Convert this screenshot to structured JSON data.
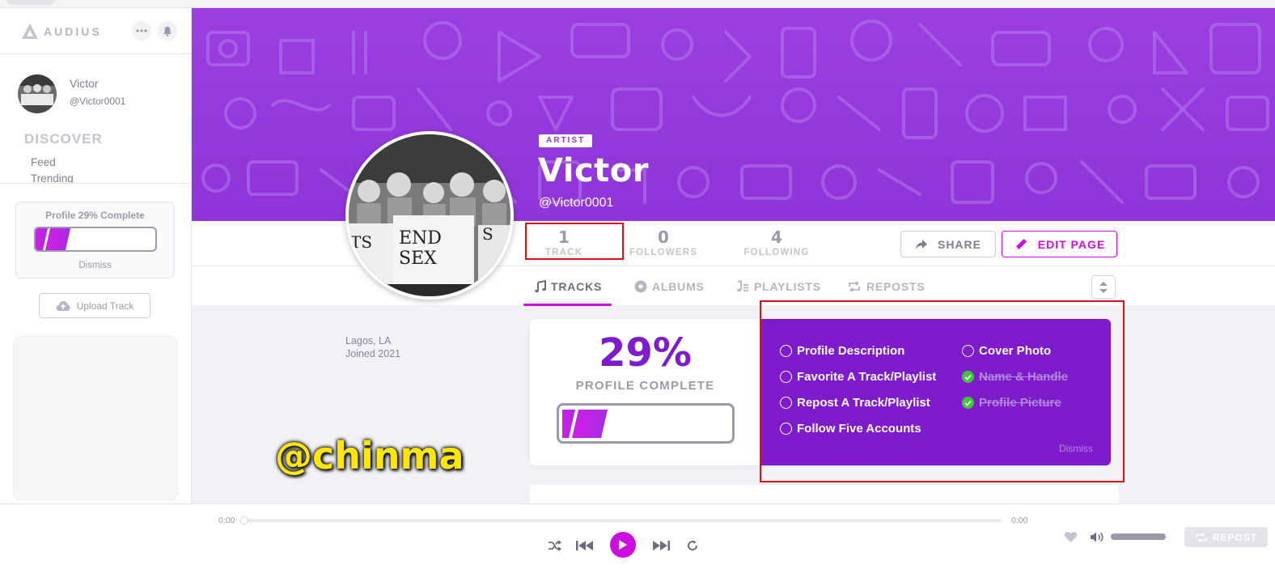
{
  "colors": {
    "accent": "#cc0fe0",
    "cover_purple": "#9b3fe0",
    "checklist_purple": "#7e1bcc",
    "highlight_red": "#e0101a",
    "done_green": "#3fc536",
    "watermark_yellow": "#ffe60a"
  },
  "sidebar": {
    "logo_text": "AUDIUS",
    "user": {
      "name": "Victor",
      "handle": "@Victor0001"
    },
    "discover_heading": "DISCOVER",
    "links": [
      "Feed",
      "Trending"
    ],
    "profile_progress": {
      "title": "Profile 29% Complete",
      "percent": 29,
      "dismiss": "Dismiss"
    },
    "upload_label": "Upload Track"
  },
  "profile": {
    "badge": "ARTIST",
    "name": "Victor",
    "handle": "@Victor0001",
    "stats": [
      {
        "value": "1",
        "label": "TRACK"
      },
      {
        "value": "0",
        "label": "FOLLOWERS"
      },
      {
        "value": "4",
        "label": "FOLLOWING"
      }
    ],
    "share_label": "SHARE",
    "edit_label": "EDIT PAGE",
    "location": "Lagos, LA",
    "joined": "Joined 2021"
  },
  "tabs": [
    {
      "label": "TRACKS",
      "icon": "music-note-icon",
      "active": true
    },
    {
      "label": "ALBUMS",
      "icon": "album-icon",
      "active": false
    },
    {
      "label": "PLAYLISTS",
      "icon": "playlist-icon",
      "active": false
    },
    {
      "label": "REPOSTS",
      "icon": "repost-icon",
      "active": false
    }
  ],
  "completion": {
    "percent_text": "29%",
    "label": "PROFILE COMPLETE",
    "percent": 29,
    "items_left": [
      {
        "label": "Profile Description",
        "done": false
      },
      {
        "label": "Favorite A Track/Playlist",
        "done": false
      },
      {
        "label": "Repost A Track/Playlist",
        "done": false
      },
      {
        "label": "Follow Five Accounts",
        "done": false
      }
    ],
    "items_right": [
      {
        "label": "Cover Photo",
        "done": false
      },
      {
        "label": "Name & Handle",
        "done": true
      },
      {
        "label": "Profile Picture",
        "done": true
      }
    ],
    "dismiss": "Dismiss"
  },
  "watermark": "@chinma",
  "player": {
    "time_elapsed": "0:00",
    "time_total": "0:00",
    "repost_label": "REPOST"
  }
}
